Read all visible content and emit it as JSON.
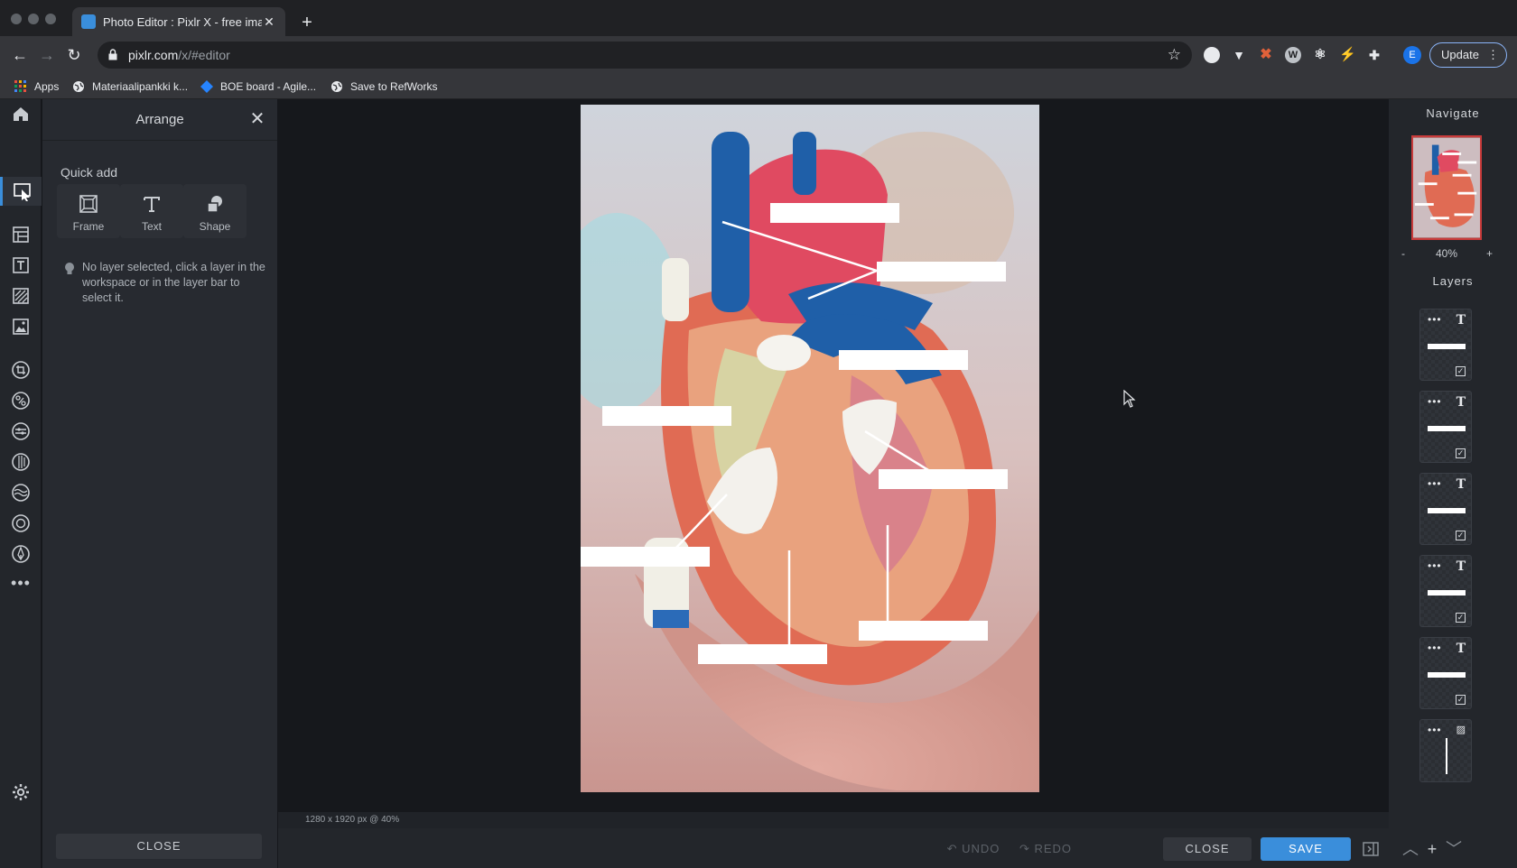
{
  "browser": {
    "tab_title": "Photo Editor : Pixlr X - free ima",
    "url_host": "pixlr.com",
    "url_path": "/x/#editor",
    "update_label": "Update",
    "profile_initial": "E",
    "bookmarks": [
      {
        "label": "Apps",
        "icon": "apps-grid-icon"
      },
      {
        "label": "Materiaalipankki k...",
        "icon": "globe-icon"
      },
      {
        "label": "BOE board - Agile...",
        "icon": "diamond-icon"
      },
      {
        "label": "Save to RefWorks",
        "icon": "globe-icon"
      }
    ]
  },
  "arrange_panel": {
    "title": "Arrange",
    "quick_add_label": "Quick add",
    "quick_add": [
      {
        "label": "Frame",
        "icon": "frame-icon"
      },
      {
        "label": "Text",
        "icon": "text-icon"
      },
      {
        "label": "Shape",
        "icon": "shape-icon"
      }
    ],
    "hint": "No layer selected, click a layer in the workspace or in the layer bar to select it.",
    "close_label": "CLOSE"
  },
  "workspace": {
    "status": "1280 x 1920 px @ 40%"
  },
  "bottom_bar": {
    "undo_label": "UNDO",
    "redo_label": "REDO",
    "close_label": "CLOSE",
    "save_label": "SAVE"
  },
  "navigate_panel": {
    "title": "Navigate",
    "zoom_out": "-",
    "zoom_level": "40%",
    "zoom_in": "+"
  },
  "layers_panel": {
    "title": "Layers",
    "layer_types": [
      "text",
      "text",
      "text",
      "text",
      "text",
      "drawing"
    ]
  },
  "colors": {
    "accent": "#3a8edb",
    "panel_bg": "#272a30",
    "workspace_bg": "#16181c"
  }
}
